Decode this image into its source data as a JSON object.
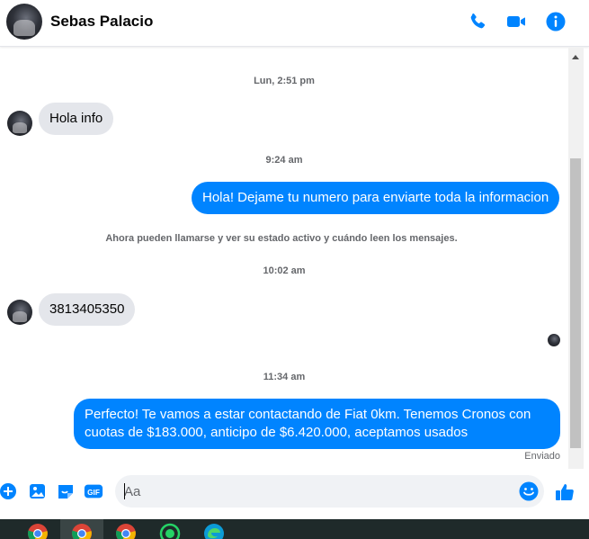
{
  "header": {
    "contact_name": "Sebas Palacio",
    "actions": [
      {
        "icon": "phone-icon",
        "label": "Call"
      },
      {
        "icon": "video-camera-icon",
        "label": "Video call"
      },
      {
        "icon": "info-icon",
        "label": "Conversation info"
      }
    ]
  },
  "colors": {
    "accent": "#0084ff",
    "incoming_bubble": "#e4e6eb",
    "meta_text": "#65676b"
  },
  "messages": {
    "ts1": "Lun, 2:51 pm",
    "msg1": "Hola info",
    "ts2": "9:24 am",
    "msg2": "Hola! Dejame tu numero para enviarte toda la informacion",
    "notice": "Ahora pueden llamarse y ver su estado activo y cuándo leen los mensajes.",
    "ts3": "10:02 am",
    "msg3": "3813405350",
    "ts4": "11:34 am",
    "msg4_line1": "Perfecto! Te vamos a estar contactando de Fiat 0km. Tenemos Cronos con",
    "msg4_line2": "cuotas de $183.000, anticipo de $6.420.000, aceptamos usados",
    "status": "Enviado"
  },
  "composer": {
    "placeholder": "Aa",
    "icons": [
      "plus-circle-icon",
      "image-icon",
      "sticker-icon",
      "gif-icon",
      "emoji-icon",
      "thumbs-up-icon"
    ]
  },
  "taskbar": {
    "apps": [
      "chrome-icon",
      "chrome-icon",
      "chrome-icon",
      "whatsapp-icon",
      "edge-icon"
    ]
  }
}
